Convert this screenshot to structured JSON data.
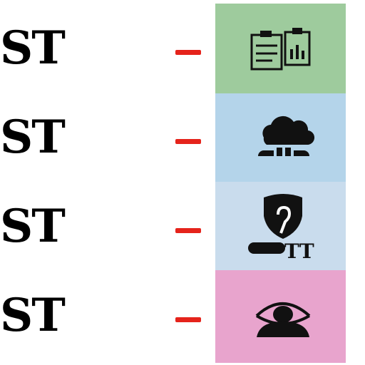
{
  "colors": {
    "dash": "#e5231b",
    "panel_1": "#9ecb9d",
    "panel_2": "#b4d4ea",
    "panel_3": "#c9dced",
    "panel_4": "#e8a4cd",
    "icon": "#111111"
  },
  "rows": [
    {
      "label": "ST",
      "icon": "clipboard-icon"
    },
    {
      "label": "ST",
      "icon": "cloud-icon"
    },
    {
      "label": "ST",
      "icon": "shield-icon",
      "panel_text": "TT"
    },
    {
      "label": "ST",
      "icon": "eye-icon"
    }
  ]
}
